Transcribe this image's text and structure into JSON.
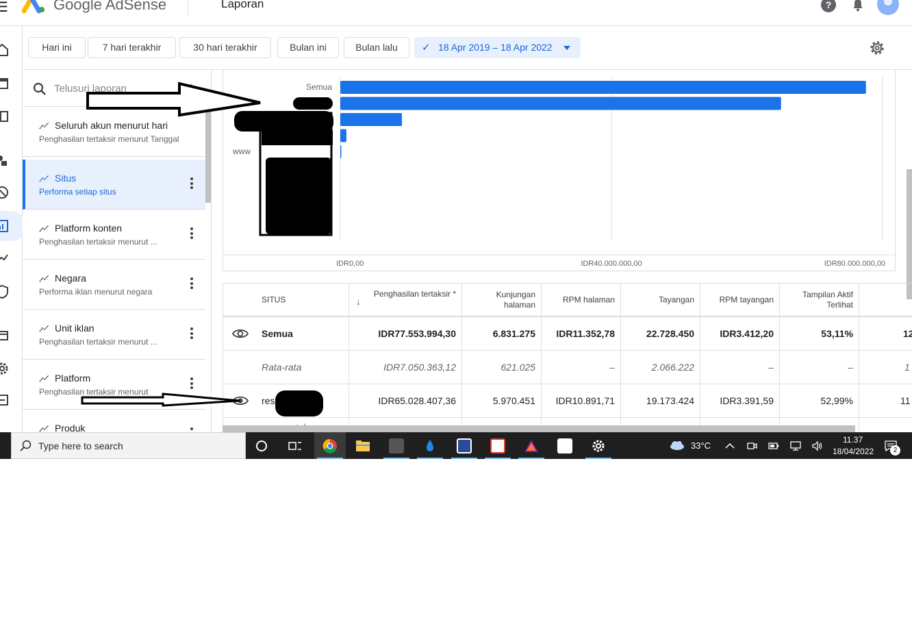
{
  "header": {
    "brand": "Google AdSense",
    "page_title": "Laporan"
  },
  "filters": {
    "chips": [
      "Hari ini",
      "7 hari terakhir",
      "30 hari terakhir",
      "Bulan ini",
      "Bulan lalu"
    ],
    "date_range": "18 Apr 2019 – 18 Apr 2022"
  },
  "reports": {
    "search_placeholder": "Telusuri laporan",
    "items": [
      {
        "title": "Seluruh akun menurut hari",
        "subtitle": "Penghasilan tertaksir menurut Tanggal"
      },
      {
        "title": "Situs",
        "subtitle": "Performa setiap situs"
      },
      {
        "title": "Platform konten",
        "subtitle": "Penghasilan tertaksir menurut ..."
      },
      {
        "title": "Negara",
        "subtitle": "Performa iklan menurut negara"
      },
      {
        "title": "Unit iklan",
        "subtitle": "Penghasilan tertaksir menurut ..."
      },
      {
        "title": "Platform",
        "subtitle": "Penghasilan tertaksir menurut"
      },
      {
        "title": "Produk",
        "subtitle": ""
      }
    ]
  },
  "chart_data": {
    "type": "bar",
    "orientation": "horizontal",
    "categories": [
      "Semua",
      "res",
      "",
      "",
      "www"
    ],
    "values": [
      77553994.3,
      65028407.36,
      9100000,
      900000,
      150000
    ],
    "x_ticks": [
      "IDR0,00",
      "IDR40.000.000,00",
      "IDR80.000.000,00"
    ],
    "xlim": [
      0,
      80000000
    ],
    "grid": true,
    "bar_color": "#1a73e8"
  },
  "table": {
    "headers": [
      "SITUS",
      "Penghasilan tertaksir *",
      "Kunjungan halaman",
      "RPM halaman",
      "Tayangan",
      "RPM tayangan",
      "Tampilan Aktif Terlihat"
    ],
    "rows": [
      {
        "name": "Semua",
        "values": [
          "IDR77.553.994,30",
          "6.831.275",
          "IDR11.352,78",
          "22.728.450",
          "IDR3.412,20",
          "53,11%",
          "12"
        ]
      },
      {
        "name": "Rata-rata",
        "values": [
          "IDR7.050.363,12",
          "621.025",
          "–",
          "2.066.222",
          "–",
          "–",
          "1"
        ]
      },
      {
        "name": "res",
        "values": [
          "IDR65.028.407,36",
          "5.970.451",
          "IDR10.891,71",
          "19.173.424",
          "IDR3.391,59",
          "52,99%",
          "11"
        ]
      }
    ],
    "partial_row": "...tuku..."
  },
  "taskbar": {
    "search_placeholder": "Type here to search",
    "weather": "33°C",
    "time": "11.37",
    "date": "18/04/2022",
    "notification_count": "2"
  }
}
